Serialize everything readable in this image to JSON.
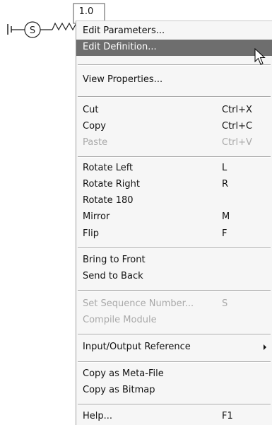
{
  "schematic": {
    "value_label": "1.0",
    "source_symbol": "S"
  },
  "menu": {
    "items": [
      {
        "label": "Edit Parameters...",
        "shortcut": ""
      },
      {
        "label": "Edit Definition...",
        "shortcut": ""
      },
      {
        "label": "View Properties...",
        "shortcut": ""
      },
      {
        "label": "Cut",
        "shortcut": "Ctrl+X"
      },
      {
        "label": "Copy",
        "shortcut": "Ctrl+C"
      },
      {
        "label": "Paste",
        "shortcut": "Ctrl+V"
      },
      {
        "label": "Rotate Left",
        "shortcut": "L"
      },
      {
        "label": "Rotate Right",
        "shortcut": "R"
      },
      {
        "label": "Rotate 180",
        "shortcut": ""
      },
      {
        "label": "Mirror",
        "shortcut": "M"
      },
      {
        "label": "Flip",
        "shortcut": "F"
      },
      {
        "label": "Bring to Front",
        "shortcut": ""
      },
      {
        "label": "Send to Back",
        "shortcut": ""
      },
      {
        "label": "Set Sequence Number...",
        "shortcut": "S"
      },
      {
        "label": "Compile Module",
        "shortcut": ""
      },
      {
        "label": "Input/Output Reference",
        "shortcut": ""
      },
      {
        "label": "Copy as Meta-File",
        "shortcut": ""
      },
      {
        "label": "Copy as Bitmap",
        "shortcut": ""
      },
      {
        "label": "Help...",
        "shortcut": "F1"
      }
    ]
  },
  "colors": {
    "highlight": "#6e6e6e",
    "disabled_text": "#a9a9a9",
    "menu_background": "#f6f6f6"
  }
}
